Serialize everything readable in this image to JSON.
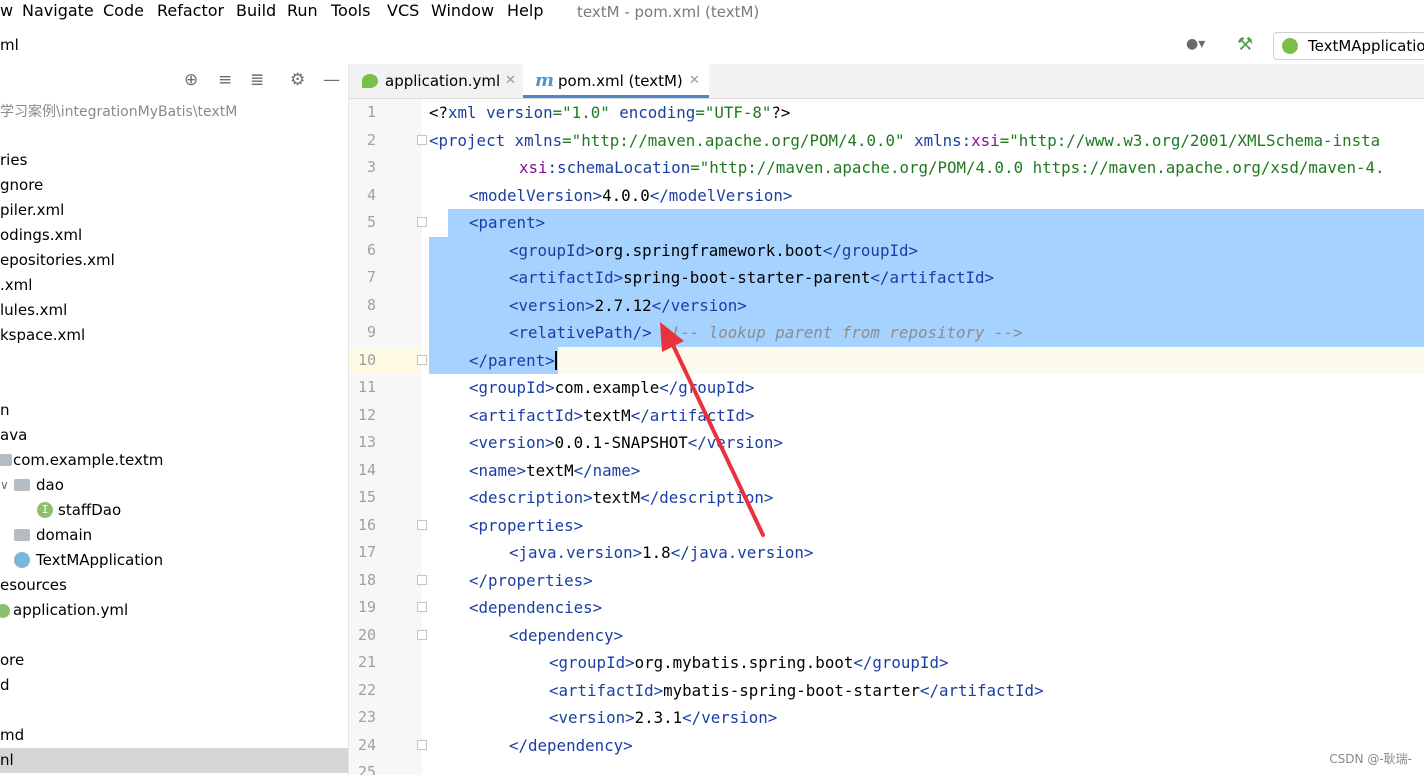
{
  "menu": {
    "items": [
      "w",
      "Navigate",
      "Code",
      "Refactor",
      "Build",
      "Run",
      "Tools",
      "VCS",
      "Window",
      "Help"
    ],
    "window_title": "textM - pom.xml (textM)"
  },
  "toolbar": {
    "project_label": "ml",
    "run_config_label": "TextMApplicatio",
    "account_icon": "account-icon",
    "build_icon": "hammer-icon"
  },
  "project_panel": {
    "path": "学习案例\\integrationMyBatis\\textM",
    "tree": [
      {
        "label": "ries"
      },
      {
        "label": "gnore"
      },
      {
        "label": "piler.xml"
      },
      {
        "label": "odings.xml"
      },
      {
        "label": "epositories.xml"
      },
      {
        "label": ".xml"
      },
      {
        "label": "lules.xml"
      },
      {
        "label": "kspace.xml"
      },
      {
        "label": ""
      },
      {
        "label": ""
      },
      {
        "label": "n"
      },
      {
        "label": "ava"
      },
      {
        "label": "com.example.textm"
      },
      {
        "label": "dao"
      },
      {
        "label": "staffDao"
      },
      {
        "label": "domain"
      },
      {
        "label": "TextMApplication"
      },
      {
        "label": "esources"
      },
      {
        "label": "application.yml"
      },
      {
        "label": ""
      },
      {
        "label": "ore"
      },
      {
        "label": "d"
      },
      {
        "label": ""
      },
      {
        "label": "md"
      },
      {
        "label": "nl"
      }
    ]
  },
  "tabs": [
    {
      "label": "application.yml",
      "icon": "spring-leaf-icon",
      "active": false
    },
    {
      "label": "pom.xml (textM)",
      "icon": "maven-m-icon",
      "active": true
    }
  ],
  "editor": {
    "line_numbers": [
      "1",
      "2",
      "3",
      "4",
      "5",
      "6",
      "7",
      "8",
      "9",
      "10",
      "11",
      "12",
      "13",
      "14",
      "15",
      "16",
      "17",
      "18",
      "19",
      "20",
      "21",
      "22",
      "23",
      "24",
      "25"
    ],
    "selection_lines": "5-10",
    "lines": {
      "l1a": "<?",
      "l1b": "xml ",
      "l1c": "version",
      "l1d": "=\"1.0\" ",
      "l1e": "encoding",
      "l1f": "=\"UTF-8\"",
      "l1g": "?>",
      "l2a": "<project ",
      "l2b": "xmlns",
      "l2c": "=\"http://maven.apache.org/POM/4.0.0\" ",
      "l2d": "xmlns:",
      "l2e": "xsi",
      "l2f": "=\"http://www.w3.org/2001/XMLSchema-insta",
      "l3a": "xsi",
      "l3b": ":schemaLocation",
      "l3c": "=\"http://maven.apache.org/POM/4.0.0 https://maven.apache.org/xsd/maven-4.",
      "l4a": "<modelVersion>",
      "l4b": "4.0.0",
      "l4c": "</modelVersion>",
      "l5a": "<parent>",
      "l6a": "<groupId>",
      "l6b": "org.springframework.boot",
      "l6c": "</groupId>",
      "l7a": "<artifactId>",
      "l7b": "spring-boot-starter-parent",
      "l7c": "</artifactId>",
      "l8a": "<version>",
      "l8b": "2.7.12",
      "l8c": "</version>",
      "l9a": "<relativePath/>",
      "l9b": " <!-- lookup parent from repository -->",
      "l10a": "</parent>",
      "l11a": "<groupId>",
      "l11b": "com.example",
      "l11c": "</groupId>",
      "l12a": "<artifactId>",
      "l12b": "textM",
      "l12c": "</artifactId>",
      "l13a": "<version>",
      "l13b": "0.0.1-SNAPSHOT",
      "l13c": "</version>",
      "l14a": "<name>",
      "l14b": "textM",
      "l14c": "</name>",
      "l15a": "<description>",
      "l15b": "textM",
      "l15c": "</description>",
      "l16a": "<properties>",
      "l17a": "<java.version>",
      "l17b": "1.8",
      "l17c": "</java.version>",
      "l18a": "</properties>",
      "l19a": "<dependencies>",
      "l20a": "<dependency>",
      "l21a": "<groupId>",
      "l21b": "org.mybatis.spring.boot",
      "l21c": "</groupId>",
      "l22a": "<artifactId>",
      "l22b": "mybatis-spring-boot-starter",
      "l22c": "</artifactId>",
      "l23a": "<version>",
      "l23b": "2.3.1",
      "l23c": "</version>",
      "l24a": "</dependency>"
    }
  },
  "annotation": {
    "arrow_color": "#e8323c"
  },
  "watermark": "CSDN @-耿瑞-"
}
